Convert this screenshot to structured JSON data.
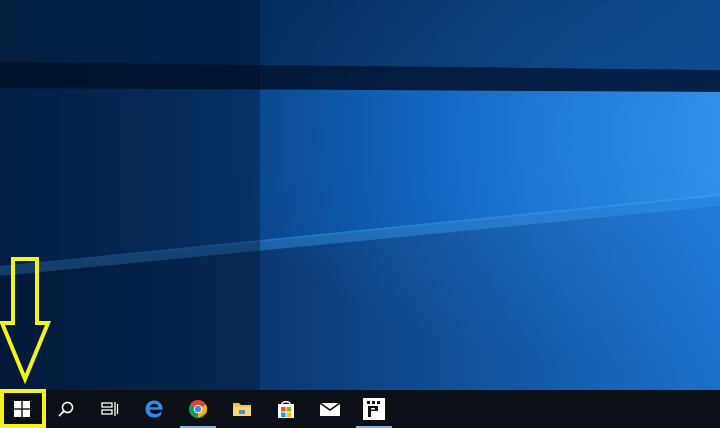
{
  "desktop": {
    "wallpaper": "windows-10-hero",
    "colors": {
      "base": "#062c5c",
      "light": "#0f6fd0",
      "glow": "#2a88e6"
    }
  },
  "annotation": {
    "color": "#f4f41a",
    "target": "start-button"
  },
  "taskbar": {
    "background": "#0b0f16",
    "items": [
      {
        "name": "start-button",
        "icon": "windows-logo-icon"
      },
      {
        "name": "search-button",
        "icon": "search-icon"
      },
      {
        "name": "task-view-button",
        "icon": "task-view-icon"
      },
      {
        "name": "edge-button",
        "icon": "edge-icon",
        "running": false
      },
      {
        "name": "chrome-button",
        "icon": "chrome-icon",
        "running": true
      },
      {
        "name": "file-explorer-button",
        "icon": "folder-icon",
        "running": false
      },
      {
        "name": "store-button",
        "icon": "store-icon",
        "running": false
      },
      {
        "name": "mail-button",
        "icon": "mail-icon",
        "running": false
      },
      {
        "name": "app-button",
        "icon": "app-p-icon",
        "running": true
      }
    ]
  }
}
